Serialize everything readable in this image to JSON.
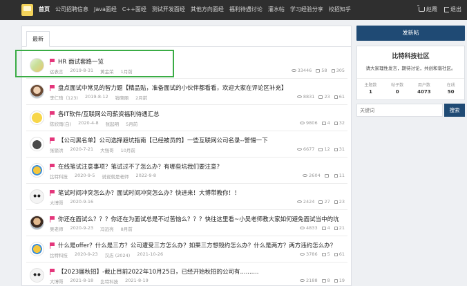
{
  "nav": {
    "items": [
      "首页",
      "公司招聘信息",
      "Java面经",
      "C++面经",
      "测试开发面经",
      "其他方向面经",
      "福利待遇讨论",
      "灌水帖",
      "学习经验分享",
      "校招知乎"
    ],
    "user": "赵霞",
    "logout": "退出"
  },
  "tabs": {
    "latest": "最新"
  },
  "posts": [
    {
      "title": "HR 面试套路一览",
      "author": "远表言",
      "date": "2019-8-31",
      "last": "黄金荣",
      "ago": "1月前",
      "views": "33446",
      "comments": "58",
      "likes": "305",
      "avatar": "shirt"
    },
    {
      "title": "盘点面试中常见的智力题【精品贴，准备面试的小伙伴都看看，欢迎大家在评论区补充】",
      "author": "李仁琦（123)",
      "date": "2019-8-12",
      "last": "钱晓丽",
      "ago": "2月前",
      "views": "8831",
      "comments": "23",
      "likes": "61",
      "avatar": "photo"
    },
    {
      "title": "各IT软件/互联网公司薪资福利待遇汇总",
      "author": "陈欣雨(白)",
      "date": "2020-4-8",
      "last": "张起明",
      "ago": "5月前",
      "views": "9806",
      "comments": "4",
      "likes": "32",
      "avatar": "emoji"
    },
    {
      "title": "【公司黑名单】公司选择避坑指南【已经被员的】一些互联网公司名录--警惕一下",
      "author": "张锁洪",
      "date": "2020-7-21",
      "last": "大强哥",
      "ago": "10月前",
      "views": "6677",
      "comments": "12",
      "likes": "31",
      "avatar": "cat"
    },
    {
      "title": "在线笔试注意事项？笔试过不了怎么办？有哪些坑我们要注意?",
      "author": "比特科技",
      "date": "2020-9-5",
      "last": "说说就是老师",
      "ago": "2022-9-8",
      "views": "2604",
      "comments": "",
      "likes": "11",
      "avatar": "logo"
    },
    {
      "title": "笔试时间冲突怎么办？面试时间冲突怎么办？快进来！大博带教你！！",
      "author": "大博哥",
      "date": "2020-9-16",
      "last": "",
      "ago": "",
      "views": "2424",
      "comments": "27",
      "likes": "23",
      "avatar": "panda"
    },
    {
      "title": "你还在面试么？？？你还在为面试总是不过苦恼么？？？快往这里看~小吴老师教大家如何避免面试当中的坑",
      "author": "吴老师",
      "date": "2020-9-23",
      "last": "冯远亮",
      "ago": "8月前",
      "views": "4833",
      "comments": "4",
      "likes": "21",
      "avatar": "photo2"
    },
    {
      "title": "什么是offer？什么是三方？公司遭受三方怎么办？如果三方想毁约怎么办？什么是两方？两方违约怎么办？",
      "author": "比特科技",
      "date": "2020-9-23",
      "last": "汉店 (2024)",
      "ago": "2021-10-26",
      "views": "3786",
      "comments": "5",
      "likes": "61",
      "avatar": "logo"
    },
    {
      "title": "【2023届秋招】-截止目前2022年10月25日，已经开始秋招的公司有..........",
      "author": "大博哥",
      "date": "2021-8-18",
      "last": "比特科技",
      "ago": "2021-8-19",
      "views": "2188",
      "comments": "8",
      "likes": "19",
      "avatar": "panda"
    }
  ],
  "sidebar": {
    "new_post": "发新帖",
    "community_name": "比特科技社区",
    "community_desc": "请大家理性发言，期待讨论，共创和谐社区。",
    "stats": [
      {
        "label": "主题数",
        "value": "1"
      },
      {
        "label": "帖子数",
        "value": "0"
      },
      {
        "label": "用户数",
        "value": "4073"
      },
      {
        "label": "在线",
        "value": "50"
      }
    ],
    "search_placeholder": "关键词",
    "search_button": "搜索"
  },
  "colors": {
    "nav_bg": "#2f2f2f",
    "accent": "#1f4a74",
    "flag": "#e4367b",
    "highlight": "#3aac45"
  }
}
